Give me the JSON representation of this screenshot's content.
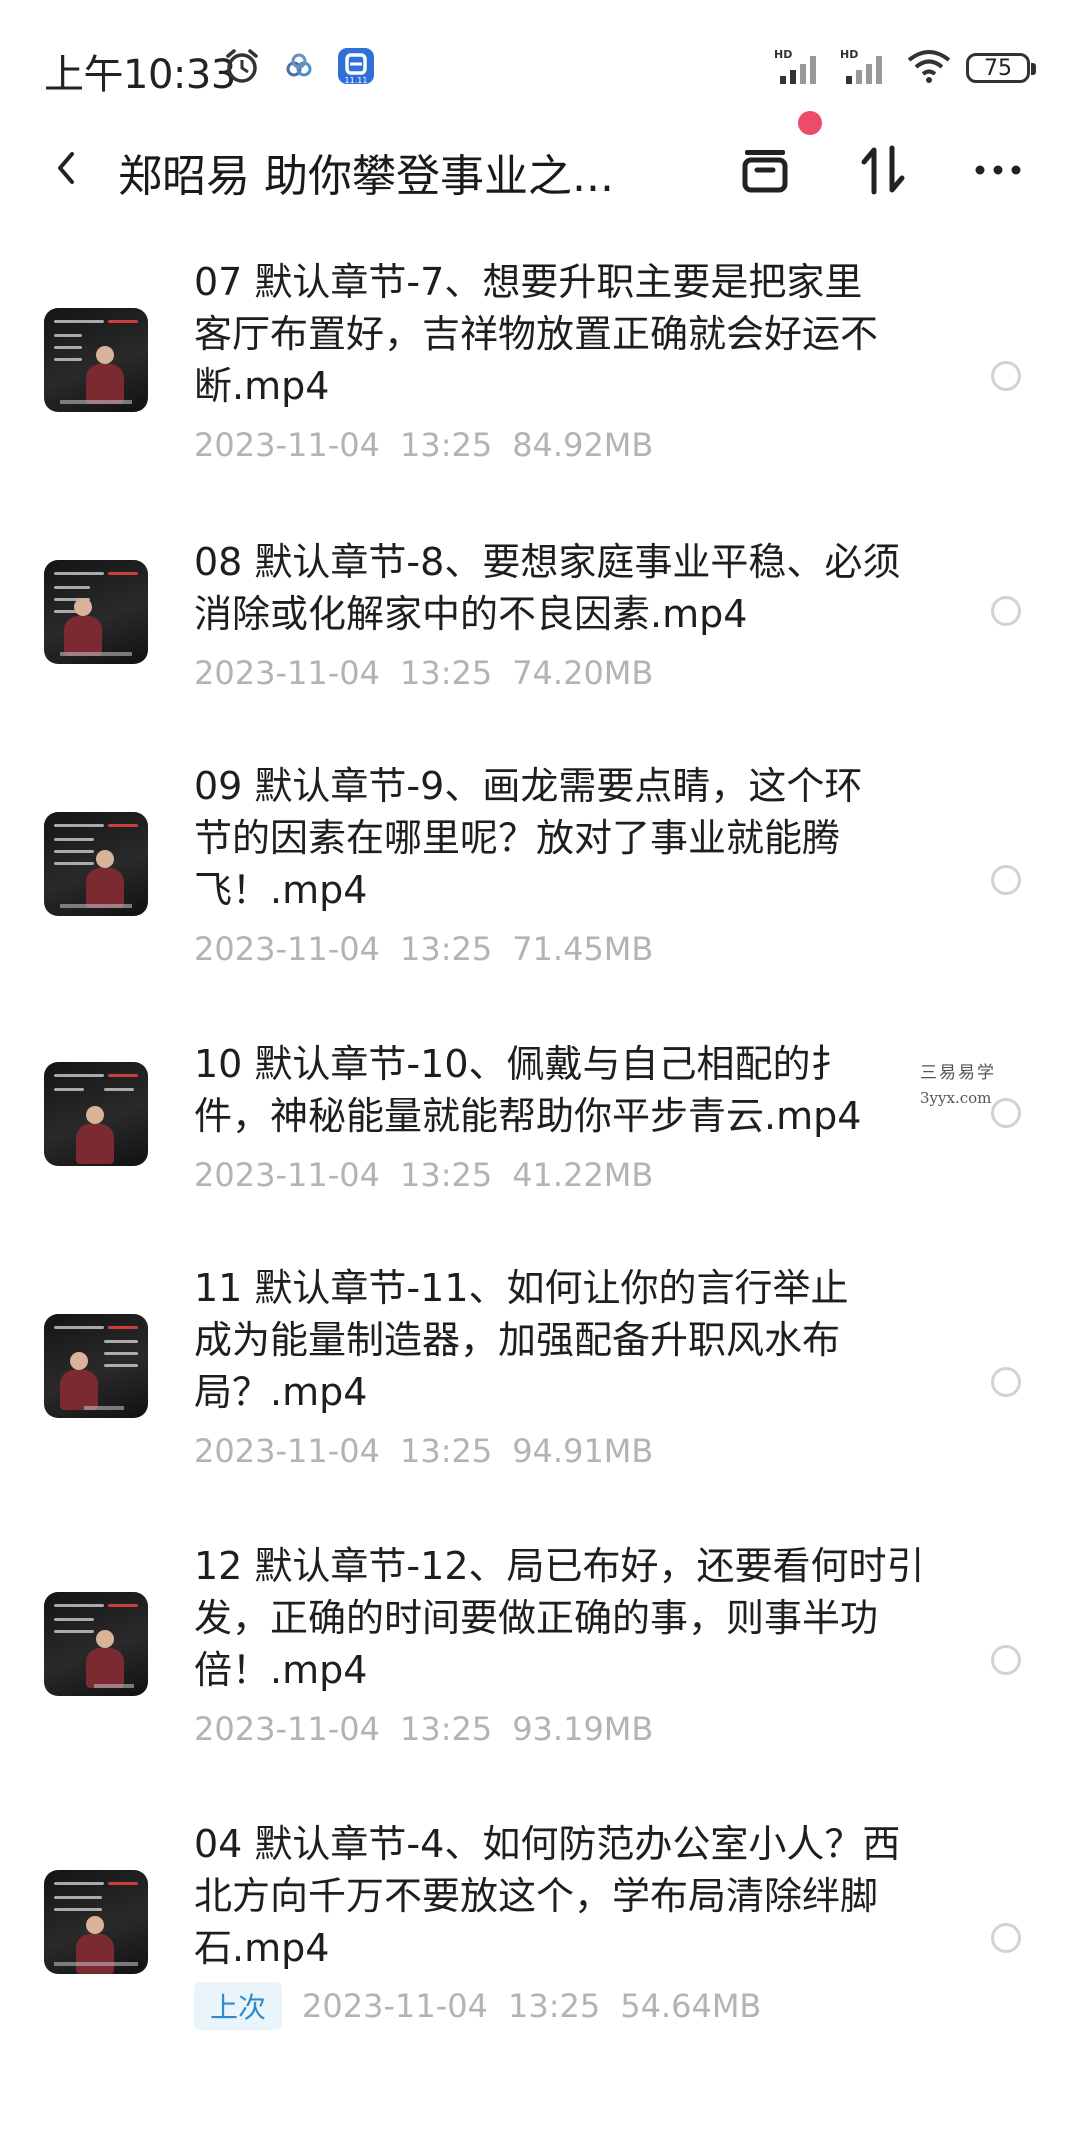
{
  "status_bar": {
    "time": "上午10:33",
    "battery": "75"
  },
  "header": {
    "title": "郑昭易 助你攀登事业之..."
  },
  "files": [
    {
      "title": "07 默认章节-7、想要升职主要是把家里客厅布置好，吉祥物放置正确就会好运不断.mp4",
      "title_lines": [
        "07 默认章节-7、想要升职主要是把家里",
        "客厅布置好，吉祥物放置正确就会好运不",
        "断.mp4"
      ],
      "date": "2023-11-04",
      "time": "13:25",
      "size": "84.92MB",
      "badge": ""
    },
    {
      "title": "08 默认章节-8、要想家庭事业平稳、必须消除或化解家中的不良因素.mp4",
      "title_lines": [
        "08 默认章节-8、要想家庭事业平稳、必须",
        "消除或化解家中的不良因素.mp4"
      ],
      "date": "2023-11-04",
      "time": "13:25",
      "size": "74.20MB",
      "badge": ""
    },
    {
      "title": "09 默认章节-9、画龙需要点睛，这个环节的因素在哪里呢？放对了事业就能腾飞！.mp4",
      "title_lines": [
        "09 默认章节-9、画龙需要点睛，这个环",
        "节的因素在哪里呢？放对了事业就能腾",
        "飞！.mp4"
      ],
      "date": "2023-11-04",
      "time": "13:25",
      "size": "71.45MB",
      "badge": ""
    },
    {
      "title": "10 默认章节-10、佩戴与自己相配的扌件，神秘能量就能帮助你平步青云.mp4",
      "title_lines": [
        "10 默认章节-10、佩戴与自己相配的扌",
        "件，神秘能量就能帮助你平步青云.mp4"
      ],
      "date": "2023-11-04",
      "time": "13:25",
      "size": "41.22MB",
      "badge": ""
    },
    {
      "title": "11 默认章节-11、如何让你的言行举止成为能量制造器，加强配备升职风水布局？.mp4",
      "title_lines": [
        "11 默认章节-11、如何让你的言行举止",
        "成为能量制造器，加强配备升职风水布",
        "局？.mp4"
      ],
      "date": "2023-11-04",
      "time": "13:25",
      "size": "94.91MB",
      "badge": ""
    },
    {
      "title": "12 默认章节-12、局已布好，还要看何时引发，正确的时间要做正确的事，则事半功倍！.mp4",
      "title_lines": [
        "12 默认章节-12、局已布好，还要看何时引",
        "发，正确的时间要做正确的事，则事半功",
        "倍！.mp4"
      ],
      "date": "2023-11-04",
      "time": "13:25",
      "size": "93.19MB",
      "badge": ""
    },
    {
      "title": "04 默认章节-4、如何防范办公室小人？西北方向千万不要放这个，学布局清除绊脚石.mp4",
      "title_lines": [
        "04 默认章节-4、如何防范办公室小人？西",
        "北方向千万不要放这个，学布局清除绊脚",
        "石.mp4"
      ],
      "date": "2023-11-04",
      "time": "13:25",
      "size": "54.64MB",
      "badge": "上次"
    }
  ],
  "watermark": {
    "line1": "三易易学",
    "line2": "3yyx.com"
  }
}
